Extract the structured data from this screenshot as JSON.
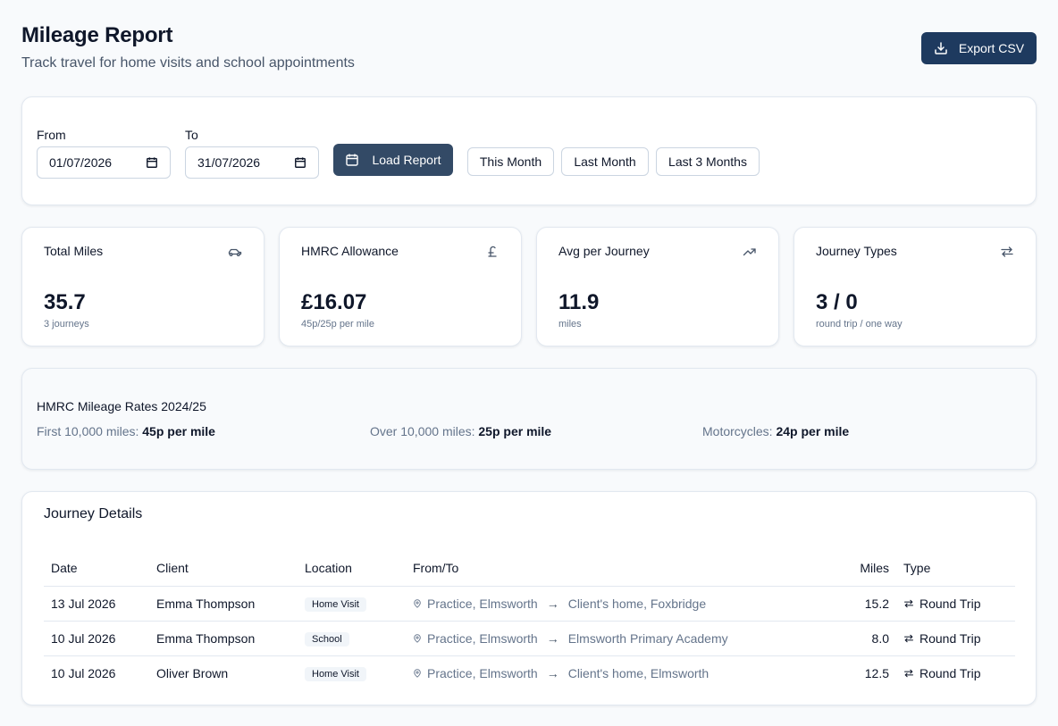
{
  "header": {
    "title": "Mileage Report",
    "subtitle": "Track travel for home visits and school appointments",
    "export_label": "Export CSV"
  },
  "filters": {
    "from_label": "From",
    "from_value": "01/07/2026",
    "to_label": "To",
    "to_value": "31/07/2026",
    "load_label": "Load Report",
    "quick": [
      "This Month",
      "Last Month",
      "Last 3 Months"
    ]
  },
  "stats": [
    {
      "label": "Total Miles",
      "icon": "car-icon",
      "value": "35.7",
      "sub": "3 journeys"
    },
    {
      "label": "HMRC Allowance",
      "icon": "pound-icon",
      "value": "£16.07",
      "sub": "45p/25p per mile"
    },
    {
      "label": "Avg per Journey",
      "icon": "trending-up-icon",
      "value": "11.9",
      "sub": "miles"
    },
    {
      "label": "Journey Types",
      "icon": "swap-icon",
      "value": "3 / 0",
      "sub": "round trip / one way"
    }
  ],
  "rates": {
    "title": "HMRC Mileage Rates 2024/25",
    "items": [
      {
        "label": "First 10,000 miles:",
        "value": "45p per mile"
      },
      {
        "label": "Over 10,000 miles:",
        "value": "25p per mile"
      },
      {
        "label": "Motorcycles:",
        "value": "24p per mile"
      }
    ]
  },
  "journeys": {
    "title": "Journey Details",
    "columns": [
      "Date",
      "Client",
      "Location",
      "From/To",
      "Miles",
      "Type"
    ],
    "rows": [
      {
        "date": "13 Jul 2026",
        "client": "Emma Thompson",
        "location": "Home Visit",
        "from": "Practice, Elmsworth",
        "to": "Client's home, Foxbridge",
        "miles": "15.2",
        "type": "Round Trip"
      },
      {
        "date": "10 Jul 2026",
        "client": "Emma Thompson",
        "location": "School",
        "from": "Practice, Elmsworth",
        "to": "Elmsworth Primary Academy",
        "miles": "8.0",
        "type": "Round Trip"
      },
      {
        "date": "10 Jul 2026",
        "client": "Oliver Brown",
        "location": "Home Visit",
        "from": "Practice, Elmsworth",
        "to": "Client's home, Elmsworth",
        "miles": "12.5",
        "type": "Round Trip"
      }
    ]
  },
  "colors": {
    "primary": "#1e3a5f",
    "load_button": "#334a66",
    "background": "#f8fafc"
  }
}
